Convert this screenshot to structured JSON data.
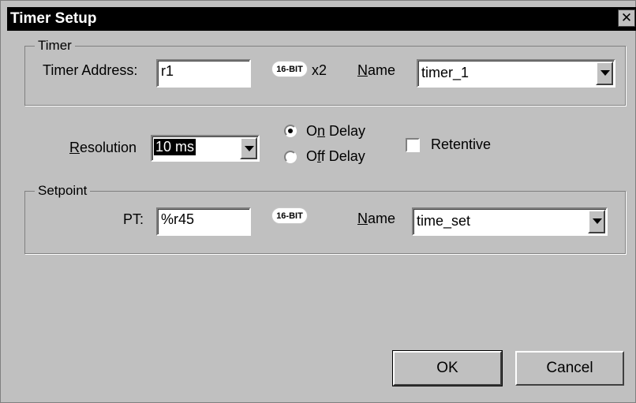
{
  "window": {
    "title": "Timer Setup",
    "close_symbol": "✕"
  },
  "timer_group": {
    "label": "Timer",
    "address_label": "Timer Address:",
    "address_value": "r1",
    "badge": "16-BIT",
    "multiplier": "x2",
    "name_label_u": "N",
    "name_label_rest": "ame",
    "name_value": "timer_1"
  },
  "resolution": {
    "label_u": "R",
    "label_rest": "esolution",
    "value": "10 ms"
  },
  "delay": {
    "on_pre": "O",
    "on_u": "n",
    "on_rest": " Delay",
    "off_pre": "O",
    "off_u": "f",
    "off_rest": "f Delay",
    "selected": "On Delay"
  },
  "retentive": {
    "label": "Retentive",
    "checked": false
  },
  "setpoint_group": {
    "label": "Setpoint",
    "pt_label": "PT:",
    "pt_value": "%r45",
    "badge": "16-BIT",
    "name_label_u": "N",
    "name_label_rest": "ame",
    "name_value": "time_set"
  },
  "buttons": {
    "ok": "OK",
    "cancel": "Cancel"
  }
}
